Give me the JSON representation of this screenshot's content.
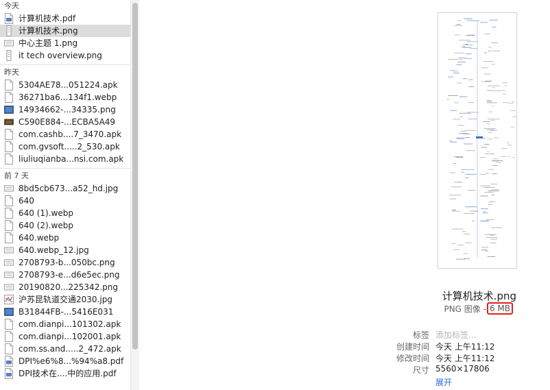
{
  "sidebar": {
    "groups": [
      {
        "header": "今天",
        "items": [
          {
            "label": "计算机技术.pdf",
            "icon": "pdf-file-icon"
          },
          {
            "label": "计算机技术.png",
            "icon": "tall-image-file-icon",
            "selected": true
          },
          {
            "label": "中心主题 1.png",
            "icon": "wide-image-file-icon"
          },
          {
            "label": "it tech overview.png",
            "icon": "tall-image-file-icon"
          }
        ]
      },
      {
        "header": "昨天",
        "items": [
          {
            "label": "5304AE78...051224.apk",
            "icon": "blank-file-icon"
          },
          {
            "label": "36271ba6...134f1.webp",
            "icon": "blank-file-icon"
          },
          {
            "label": "14934662-...34335.png",
            "icon": "blue-image-file-icon"
          },
          {
            "label": "C590E884-...ECBA5A49",
            "icon": "dark-image-file-icon"
          },
          {
            "label": "com.cashb....7_3470.apk",
            "icon": "blank-file-icon"
          },
          {
            "label": "com.gvsoft.....2_530.apk",
            "icon": "blank-file-icon"
          },
          {
            "label": "liuliuqianba...nsi.com.apk",
            "icon": "blank-file-icon"
          }
        ]
      },
      {
        "header": "前 7 天",
        "items": [
          {
            "label": "8bd5cb673...a52_hd.jpg",
            "icon": "wide-image-file-icon"
          },
          {
            "label": "640",
            "icon": "blank-file-icon"
          },
          {
            "label": "640 (1).webp",
            "icon": "blank-file-icon"
          },
          {
            "label": "640 (2).webp",
            "icon": "blank-file-icon"
          },
          {
            "label": "640.webp",
            "icon": "blank-file-icon"
          },
          {
            "label": "640.webp_12.jpg",
            "icon": "wide-image-file-icon"
          },
          {
            "label": "2708793-b...050bc.png",
            "icon": "wide-image-file-icon"
          },
          {
            "label": "2708793-e...d6e5ec.png",
            "icon": "wide-image-file-icon"
          },
          {
            "label": "20190820...225342.png",
            "icon": "wide-image-file-icon"
          },
          {
            "label": "沪苏昆轨道交通2030.jpg",
            "icon": "map-image-file-icon"
          },
          {
            "label": "B31844FB-...5416E031",
            "icon": "blue-image-file-icon"
          },
          {
            "label": "com.dianpi...101302.apk",
            "icon": "blank-file-icon"
          },
          {
            "label": "com.dianpi...102001.apk",
            "icon": "blank-file-icon"
          },
          {
            "label": "com.ss.and.....2_472.apk",
            "icon": "blank-file-icon"
          },
          {
            "label": "DPI%e6%8...%94%a8.pdf",
            "icon": "pdf-file-icon"
          },
          {
            "label": "DPI技术在....中的应用.pdf",
            "icon": "pdf-file-icon"
          }
        ]
      }
    ]
  },
  "preview": {
    "filename": "计算机技术.png",
    "kind": "PNG 图像 - ",
    "size": "6 MB",
    "size_highlight_color": "#e5201a",
    "meta": [
      {
        "key": "标签",
        "value": "添加标签...",
        "placeholder": true
      },
      {
        "key": "创建时间",
        "value": "今天 上午11:12"
      },
      {
        "key": "修改时间",
        "value": "今天 上午11:12"
      },
      {
        "key": "尺寸",
        "value": "5560×17806"
      }
    ],
    "expand_label": "展开",
    "link_color": "#2a6ad8"
  }
}
